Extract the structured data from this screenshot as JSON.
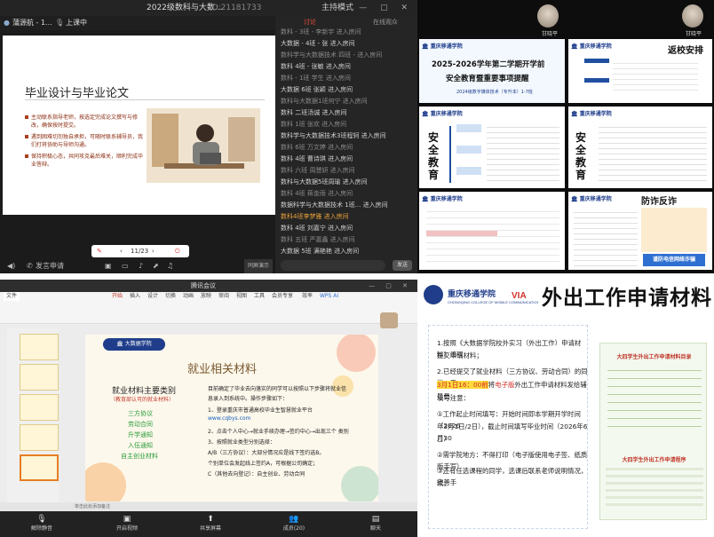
{
  "q1": {
    "window_title": "2022级数科与大数...",
    "meeting_id": "ID:21181733",
    "host_badge": "主持模式",
    "speaker_name": "蒲源航 - 1...",
    "speaking_status": "上课中",
    "slide": {
      "title": "毕业设计与毕业论文",
      "bullets": [
        "主动联系指导老师，按选定完成论文撰写与修改，确保按时提交。",
        "遇到困难切勿独自承担，可随时联系辅导员，我们打将协助与导师沟通。",
        "保持积极心态，共同攻克最后难关，顺利完成毕业答辩。"
      ]
    },
    "page_indicator": "11/23",
    "bottom_left": "发言申请",
    "bottom_right": "同屏演示",
    "side_tabs": [
      "讨论",
      "在线观众"
    ],
    "chat": [
      "数科 - 3班 - 李新宇 进入房间",
      "大数据 - 4班 - 张 进入房间",
      "数科学与大数据技术 四班 - 进入房间",
      "数科 4班 - 张敏 进入房间",
      "数科 - 1班 学生 进入房间",
      "大数据 6班 张颖 进入房间",
      "数科与大数据1班何宁 进入房间",
      "数科 二班汤诚 进入房间",
      "数科 1班 张欢 进入房间",
      "数科学与大数据技术3班程轲 进入房间",
      "数科 6班 万文婷 进入房间",
      "数科 4班 曹诗琪 进入房间",
      "数科 六班 周慧妍 进入房间",
      "数科与大数据5班周瑜 进入房间",
      "数科 4班 蒋金雨 进入房间",
      "数据科学与大数据技术 1班... 进入房间",
      "数科4班李梦雅 进入房间",
      "数科 4班 刘嘉宁 进入房间",
      "数科 五班 严嘉鑫 进入房间",
      "大数据 5班 满艳艳 进入房间"
    ],
    "send_label": "发送"
  },
  "q2": {
    "viewer1": "甘晓平",
    "viewer2": "甘晓平",
    "slide1": {
      "line1": "2025-2026学年第二学期开学前",
      "line2": "安全教育暨重要事项提醒",
      "sub": "2024级数字媒体技术（专升本）1-7班"
    },
    "slide2_title": "返校安排",
    "slide3_title": "安全教育",
    "slide4_title": "安全教育",
    "slide6_title": "防诈反诈",
    "slide6_caption": "谨防电信网络诈骗"
  },
  "q3": {
    "window_title": "腾讯会议",
    "ribbon_tabs": [
      "开始",
      "插入",
      "设计",
      "切换",
      "动画",
      "放映",
      "审阅",
      "视图",
      "工具",
      "会员专享",
      "效率",
      "WPS AI"
    ],
    "file_label": "文件",
    "slide": {
      "title": "就业相关材料",
      "sub_title": "就业材料主要类别",
      "sub_note": "（教育部认可的就业材料）",
      "green_items": [
        "三方协议",
        "劳动合同",
        "升学通知",
        "入伍通知",
        "自主创业材料"
      ],
      "right_lines": [
        "目前确定了毕业去向落实的同学可以按照以下步骤将就业信",
        "息录入到系统中。操作步骤如下：",
        "1、登录重庆市普通高校毕业生智慧就业平台",
        "www.cqbys.com",
        "2、点击个人中心→就业手续办理→签约中心→出现三个 类别",
        "3、按照就业类型分别选择：",
        "A/B（三方协议）：大部分情况应是线下签约选B。",
        "个别单位会发起线上签约A，可根据公司确定；",
        "C（其他去向登记）：自主创业、劳动合同"
      ]
    },
    "status_bar": "单击此处添加备注",
    "controls": [
      "解除静音",
      "开启视频",
      "共享屏幕",
      "成员(20)",
      "聊天"
    ]
  },
  "q4": {
    "title": "外出工作申请材料",
    "school": "重庆移通学院 · 大数据学院",
    "lines": [
      "1.按照《大数据学院校外实习（外出工作）申请材料》流程",
      "提交申请材料；",
      "2.已经提交了就业材料（三方协议、劳动合同）的同学，于",
      "3月1日16：00前将电子版外出工作申请材料发给辅导员；",
      "填写注意：",
      "①工作起止时间填写：开始时间即本学期开学时间（2026",
      "年3月1日/2日），截止时间填写毕业时间（2026年6月30",
      "日）",
      "②需学院地方：不得打印（电子版使用电子签、纸质版手写）",
      "③还有任选课程的同学，选课后联系老师说明情况，完善手",
      "续。"
    ],
    "highlight_date": "3月1日16：00前",
    "highlight_ebook": "电子版",
    "ref_title": "大四学生外出工作申请材料目录",
    "ref_title2": "大四学生外出工作申请程序"
  }
}
